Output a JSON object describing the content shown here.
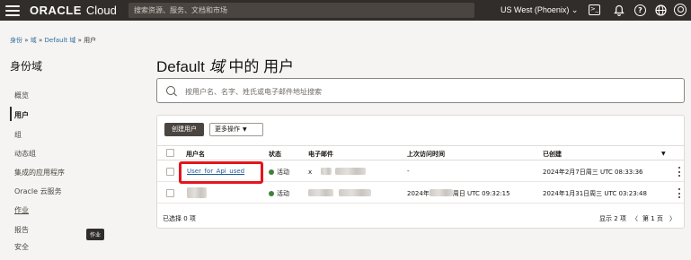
{
  "topbar": {
    "brand_oracle": "ORACLE",
    "brand_cloud": "Cloud",
    "search_placeholder": "搜索资源、服务、文档和市场",
    "region": "US West (Phoenix)",
    "region_caret": "⌄",
    "icons": [
      "code-editor-icon",
      "bell-icon",
      "help-icon",
      "globe-icon",
      "profile-icon"
    ]
  },
  "breadcrumb": {
    "items": [
      "身份",
      "域",
      "Default 域",
      "用户"
    ],
    "separator": "»"
  },
  "sidebar": {
    "title": "身份域",
    "items": [
      {
        "label": "概览"
      },
      {
        "label": "用户"
      },
      {
        "label": "组"
      },
      {
        "label": "动态组"
      },
      {
        "label": "集成的应用程序"
      },
      {
        "label": "Oracle 云服务"
      },
      {
        "label": "作业"
      },
      {
        "label": "报告"
      },
      {
        "label": "安全"
      }
    ],
    "active_index": 1,
    "tooltip": "作业"
  },
  "page": {
    "title_prefix": "Default",
    "title_italic": "域",
    "title_suffix": "中的 用户",
    "search_placeholder": "按用户名、名字、姓氏或电子邮件地址搜索"
  },
  "toolbar": {
    "create_label": "创建用户",
    "more_label": "更多操作",
    "more_caret": "▼"
  },
  "table": {
    "columns": [
      "用户名",
      "状态",
      "电子邮件",
      "上次访问时间",
      "已创建"
    ],
    "sort_caret": "▼",
    "rows": [
      {
        "username": "User_for_Api_used",
        "status": "活动",
        "email_visible": "x",
        "last_access": "-",
        "created": "2024年2月7日周三 UTC 08:33:36"
      },
      {
        "username": "",
        "status": "活动",
        "email_visible": "",
        "last_access_prefix": "2024年",
        "last_access_suffix": "周日 UTC 09:32:15",
        "created": "2024年1月31日周三 UTC 03:23:48"
      }
    ]
  },
  "footer": {
    "selected": "已选择 0 项",
    "showing": "显示 2 项",
    "page_prev": "〈",
    "page_label": "第 1 页",
    "page_next": "〉"
  },
  "colors": {
    "topbar_bg": "#312d2a",
    "link": "#1e5a9a",
    "active_status": "#418139",
    "highlight_box": "#e4151c",
    "primary_button": "#4a4541"
  }
}
